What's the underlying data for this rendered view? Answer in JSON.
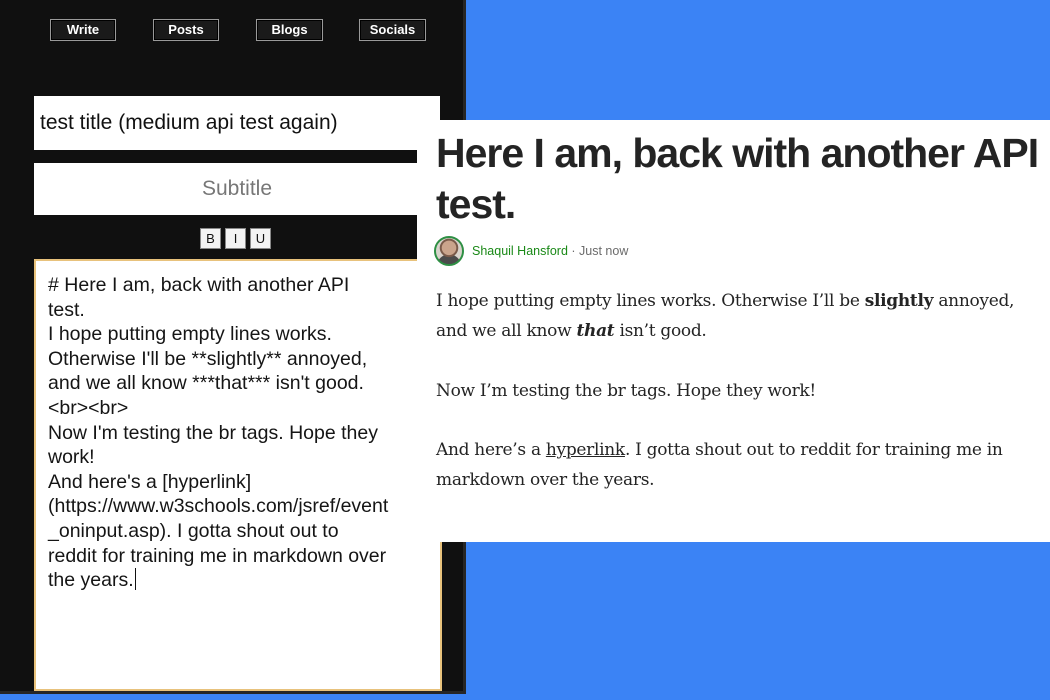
{
  "editor": {
    "nav": [
      "Write",
      "Posts",
      "Blogs",
      "Socials"
    ],
    "title_value": "test title (medium api test again)",
    "subtitle_placeholder": "Subtitle",
    "format_buttons": [
      "B",
      "I",
      "U"
    ],
    "body_lines": [
      "# Here I am, back with another API",
      "test.",
      "",
      "I hope putting empty lines works.",
      "Otherwise I'll be **slightly** annoyed,",
      "and we all know ***that*** isn't good.",
      "<br><br>",
      "Now I'm testing the br tags. Hope they",
      "work!",
      "",
      "And here's a [hyperlink]",
      "(https://www.w3schools.com/jsref/event",
      "_oninput.asp). I gotta shout out to",
      "reddit for training me in markdown over",
      "the years."
    ]
  },
  "article": {
    "title": "Here I am, back with another API test.",
    "author": "Shaquil Hansford",
    "separator": " · ",
    "time": "Just now",
    "p1_a": "I hope putting empty lines works. Otherwise I’ll be ",
    "p1_bold": "slightly",
    "p1_b": " annoyed, and we all know ",
    "p1_bolditalic": "that",
    "p1_c": " isn’t good.",
    "p2": "Now I’m testing the br tags. Hope they work!",
    "p3_a": "And here’s a ",
    "p3_link": "hyperlink",
    "p3_b": ". I gotta shout out to reddit for training me in markdown over the years."
  },
  "colors": {
    "background": "#3b83f5",
    "editor_bg": "#101010",
    "author_green": "#1a8917"
  }
}
